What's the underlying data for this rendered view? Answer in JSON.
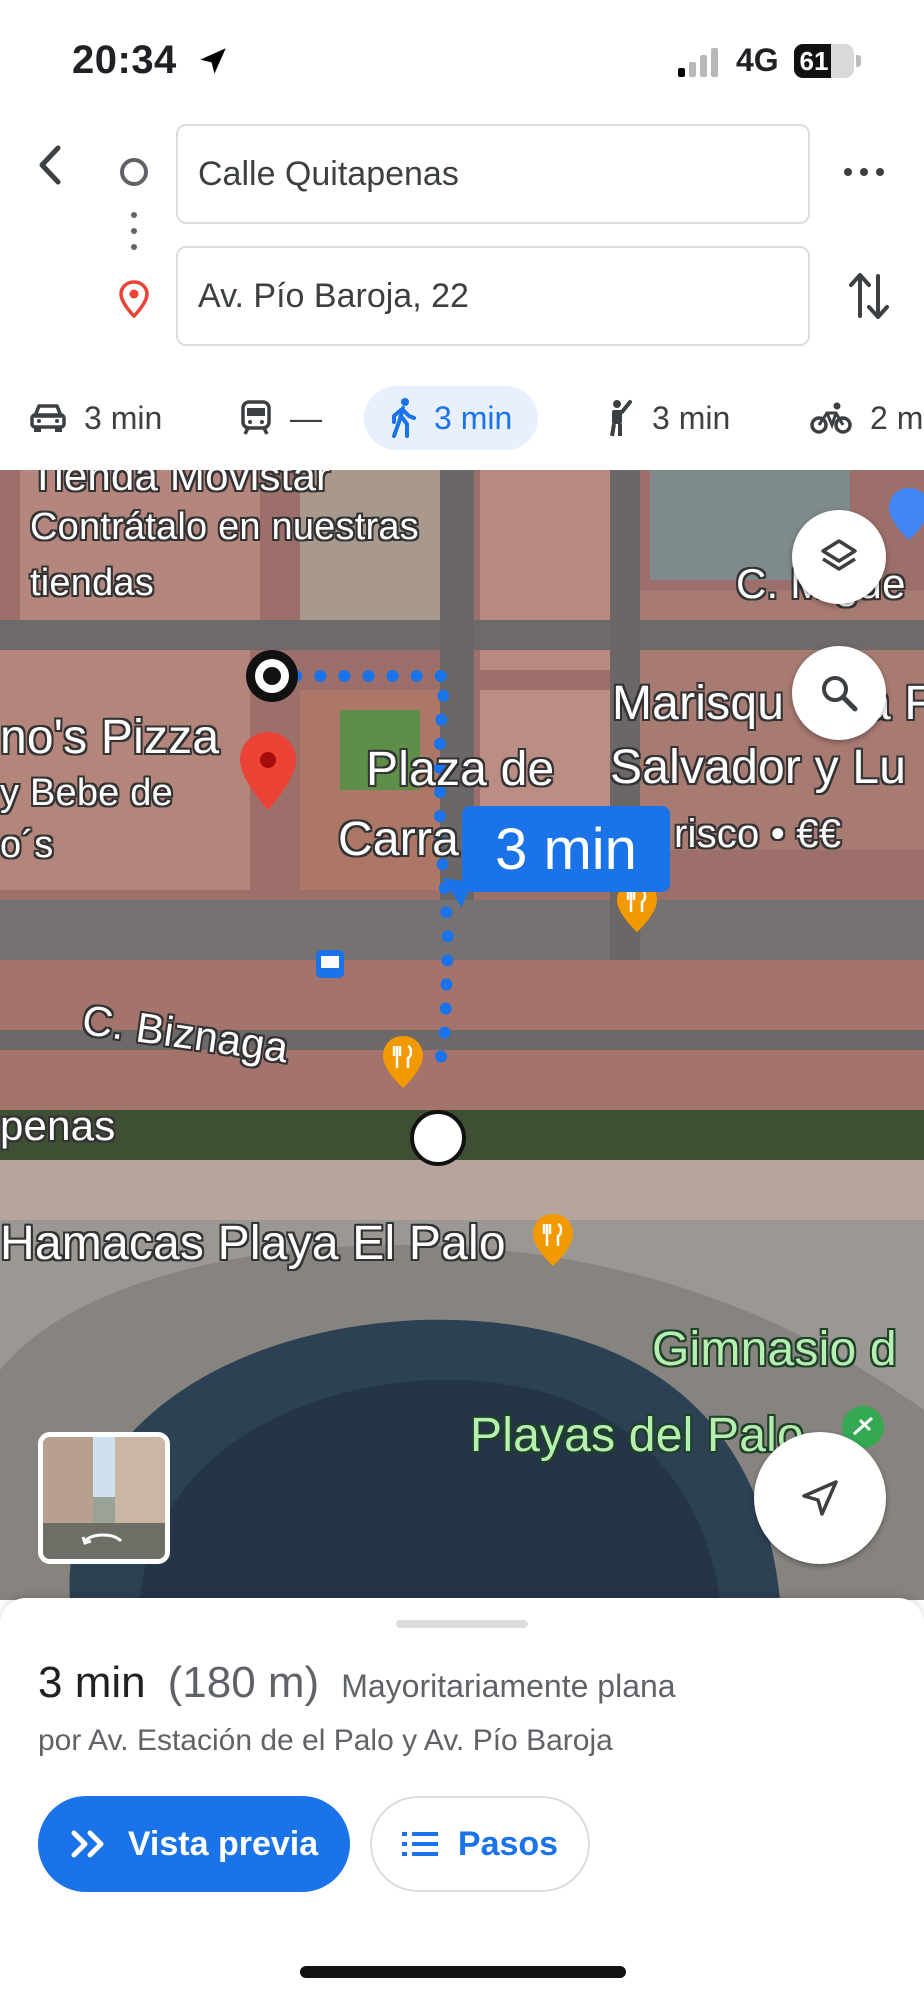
{
  "status_bar": {
    "time": "20:34",
    "network": "4G",
    "battery_level": "61",
    "battery_fraction": 0.61
  },
  "directions": {
    "origin": "Calle Quitapenas",
    "destination": "Av. Pío Baroja, 22"
  },
  "modes": [
    {
      "name": "driving",
      "icon": "car-icon",
      "label": "3 min"
    },
    {
      "name": "transit",
      "icon": "train-icon",
      "label": "—"
    },
    {
      "name": "walking",
      "icon": "walk-icon",
      "label": "3 min",
      "selected": true
    },
    {
      "name": "ride",
      "icon": "hail-icon",
      "label": "3 min"
    },
    {
      "name": "cycling",
      "icon": "bike-icon",
      "label": "2 m"
    }
  ],
  "map": {
    "labels": {
      "ad_top": "Tienda Movistar",
      "ad_line1": "Contrátalo en nuestras",
      "ad_line2": "tiendas",
      "street_top_right": "C. Migue",
      "pizza": "no's Pizza",
      "bebe": "y Bebe de",
      "bebe2": "o´s",
      "plaza1": "Plaza de",
      "plaza2": "Carra",
      "marisq1": "Marisqu",
      "marisq1b": "a F",
      "marisq2": "Salvador y Lu",
      "marisq3": "risco • €€",
      "biznaga": "C. Biznaga",
      "penas": "penas",
      "hamacas": "Hamacas Playa El Palo",
      "gimnasio": "Gimnasio d",
      "playas": "Playas del Palo"
    },
    "eta": "3 min"
  },
  "sheet": {
    "duration": "3 min",
    "distance": "(180 m)",
    "terrain": "Mayoritariamente plana",
    "via": "por Av. Estación de el Palo y Av. Pío Baroja",
    "preview_label": "Vista previa",
    "steps_label": "Pasos"
  },
  "colors": {
    "accent": "#1a73e8",
    "selected_bg": "#e8f0fe",
    "pin_red": "#ea4335"
  }
}
